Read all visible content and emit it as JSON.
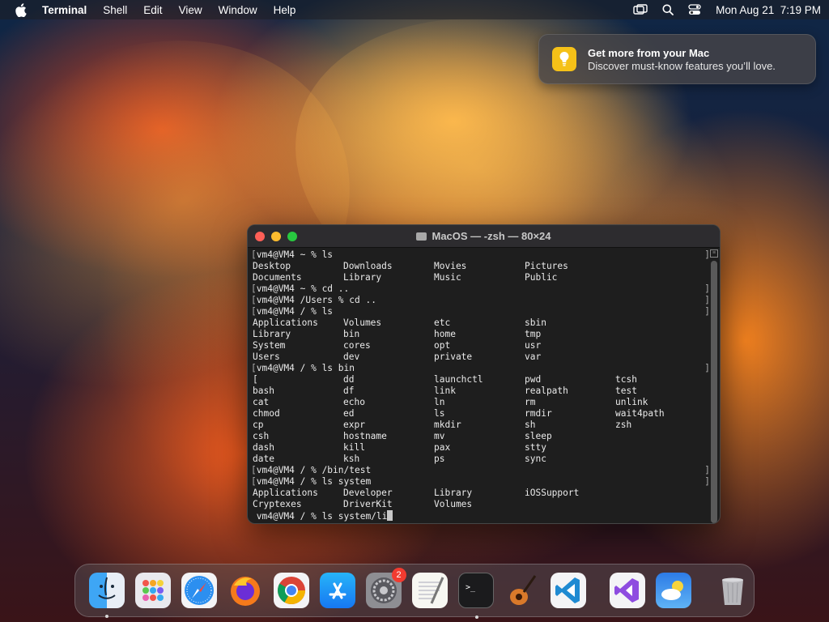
{
  "menubar": {
    "app_name": "Terminal",
    "items": [
      "Shell",
      "Edit",
      "View",
      "Window",
      "Help"
    ],
    "datetime": "Mon Aug 21  7:19 PM"
  },
  "notification": {
    "title": "Get more from your Mac",
    "body": "Discover must-know features you’ll love."
  },
  "terminal": {
    "title": "MacOS — -zsh — 80×24",
    "lines": [
      {
        "type": "prompt",
        "text": "vm4@VM4 ~ % ls"
      },
      {
        "type": "cols",
        "cells": [
          "Desktop",
          "Downloads",
          "Movies",
          "Pictures"
        ]
      },
      {
        "type": "cols",
        "cells": [
          "Documents",
          "Library",
          "Music",
          "Public"
        ]
      },
      {
        "type": "prompt",
        "text": "vm4@VM4 ~ % cd .."
      },
      {
        "type": "prompt",
        "text": "vm4@VM4 /Users % cd .."
      },
      {
        "type": "prompt",
        "text": "vm4@VM4 / % ls"
      },
      {
        "type": "cols",
        "cells": [
          "Applications",
          "Volumes",
          "etc",
          "sbin"
        ]
      },
      {
        "type": "cols",
        "cells": [
          "Library",
          "bin",
          "home",
          "tmp"
        ]
      },
      {
        "type": "cols",
        "cells": [
          "System",
          "cores",
          "opt",
          "usr"
        ]
      },
      {
        "type": "cols",
        "cells": [
          "Users",
          "dev",
          "private",
          "var"
        ]
      },
      {
        "type": "prompt",
        "text": "vm4@VM4 / % ls bin"
      },
      {
        "type": "cols",
        "cells": [
          "[",
          "dd",
          "launchctl",
          "pwd",
          "tcsh"
        ]
      },
      {
        "type": "cols",
        "cells": [
          "bash",
          "df",
          "link",
          "realpath",
          "test"
        ]
      },
      {
        "type": "cols",
        "cells": [
          "cat",
          "echo",
          "ln",
          "rm",
          "unlink"
        ]
      },
      {
        "type": "cols",
        "cells": [
          "chmod",
          "ed",
          "ls",
          "rmdir",
          "wait4path"
        ]
      },
      {
        "type": "cols",
        "cells": [
          "cp",
          "expr",
          "mkdir",
          "sh",
          "zsh"
        ]
      },
      {
        "type": "cols",
        "cells": [
          "csh",
          "hostname",
          "mv",
          "sleep",
          ""
        ]
      },
      {
        "type": "cols",
        "cells": [
          "dash",
          "kill",
          "pax",
          "stty",
          ""
        ]
      },
      {
        "type": "cols",
        "cells": [
          "date",
          "ksh",
          "ps",
          "sync",
          ""
        ]
      },
      {
        "type": "prompt",
        "text": "vm4@VM4 / % /bin/test"
      },
      {
        "type": "prompt",
        "text": "vm4@VM4 / % ls system"
      },
      {
        "type": "cols",
        "cells": [
          "Applications",
          "Developer",
          "Library",
          "iOSSupport"
        ]
      },
      {
        "type": "cols",
        "cells": [
          "Cryptexes",
          "DriverKit",
          "Volumes",
          ""
        ]
      },
      {
        "type": "current",
        "text": "vm4@VM4 / % ls system/li"
      }
    ]
  },
  "dock": {
    "apps": [
      {
        "icon": "finder-icon",
        "running": true
      },
      {
        "icon": "launchpad-icon",
        "running": false
      },
      {
        "icon": "safari-icon",
        "running": false
      },
      {
        "icon": "firefox-icon",
        "running": false
      },
      {
        "icon": "chrome-icon",
        "running": false
      },
      {
        "icon": "app-store-icon",
        "running": false
      },
      {
        "icon": "system-settings-icon",
        "running": false,
        "badge": "2"
      },
      {
        "icon": "textedit-icon",
        "running": false
      },
      {
        "icon": "terminal-icon",
        "running": true
      },
      {
        "icon": "garageband-icon",
        "running": false
      },
      {
        "icon": "vscode-icon",
        "running": false
      },
      {
        "icon": "visual-studio-icon",
        "running": false
      },
      {
        "icon": "weather-icon",
        "running": false
      },
      {
        "icon": "trash-icon",
        "running": false
      }
    ],
    "system_settings_badge": "2"
  },
  "colors": {
    "terminal_bg": "#1e1e1e",
    "close": "#fe5f57",
    "minimize": "#febc2e",
    "maximize": "#28c840",
    "notification_icon": "#f5c118"
  }
}
